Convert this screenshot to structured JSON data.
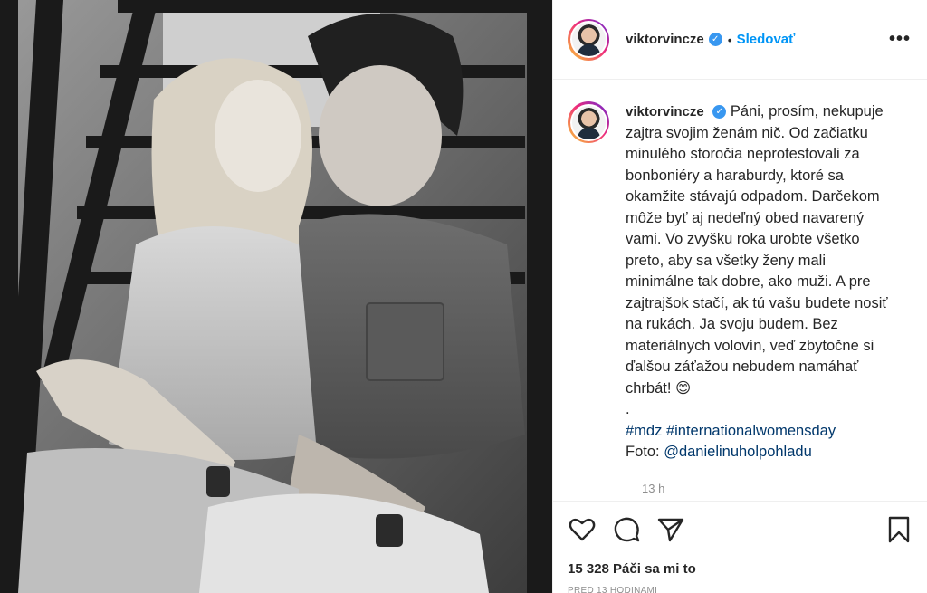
{
  "post": {
    "username": "viktorvincze",
    "verified_icon": "✓",
    "separator": "•",
    "follow_label": "Sledovať",
    "more_label": "•••"
  },
  "caption": {
    "username": "viktorvincze",
    "text": "Páni, prosím, nekupuje zajtra svojim ženám nič. Od začiatku minulého storočia neprotestovali za bonboniéry a haraburdy, ktoré sa okamžite stávajú odpadom. Darčekom môže byť aj nedeľný obed navarený vami. Vo zvyšku roka urobte všetko preto, aby sa všetky ženy mali minimálne tak dobre, ako muži. A pre zajtrajšok stačí, ak tú vašu budete nosiť na rukách. Ja svoju budem. Bez materiálnych volovín, veď zbytočne si ďalšou záťažou nebudem namáhať chrbát! 😊",
    "dot_line": ".",
    "hashtag_1": "#mdz",
    "hashtag_2": "#internationalwomensday",
    "photo_credit_label": "Foto:",
    "photo_credit_mention": "@danielinuholpohladu",
    "timestamp": "13 h"
  },
  "actions": {
    "likes_text": "15 328 Páči sa mi to",
    "posted_text": "PRED 13 HODINAMI"
  },
  "icons": {
    "like": "heart-icon",
    "comment": "comment-icon",
    "share": "share-icon",
    "save": "bookmark-icon"
  },
  "colors": {
    "link": "#0095f6",
    "hashtag": "#00376b",
    "muted": "#8e8e8e",
    "verified": "#3897f0"
  }
}
